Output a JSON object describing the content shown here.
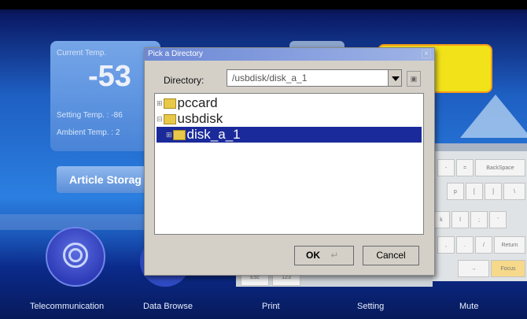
{
  "app": {
    "current_temp_label": "Current Temp.",
    "current_temp_value": "-53",
    "setting_temp_label": "Setting Temp. : -86",
    "ambient_temp_label": "Ambient Temp. : 2",
    "article_storage_label": "Article Storag"
  },
  "nav": {
    "items": [
      {
        "label": "Telecommunication"
      },
      {
        "label": "Data Browse"
      },
      {
        "label": "Print"
      },
      {
        "label": "Setting"
      },
      {
        "label": "Mute"
      }
    ]
  },
  "dialog": {
    "title": "Pick a Directory",
    "close_glyph": "×",
    "directory_label": "Directory:",
    "directory_value": "/usbdisk/disk_a_1",
    "tree": [
      {
        "label": "pccard",
        "selected": false
      },
      {
        "label": "usbdisk",
        "selected": false
      },
      {
        "label": "disk_a_1",
        "selected": true
      }
    ],
    "ok_label": "OK",
    "cancel_label": "Cancel"
  },
  "keyboard": {
    "keys": [
      "-",
      "=",
      "BackSpace",
      "p",
      "[",
      "]",
      "\\",
      "k",
      "l",
      ";",
      "'",
      ",",
      ".",
      "/",
      "Return",
      "→",
      "Focus",
      "Esc",
      "123"
    ]
  },
  "colors": {
    "selection": "#1a2a9a",
    "accent_yellow": "#f2e21a",
    "titlebar": "#6c88d6"
  }
}
